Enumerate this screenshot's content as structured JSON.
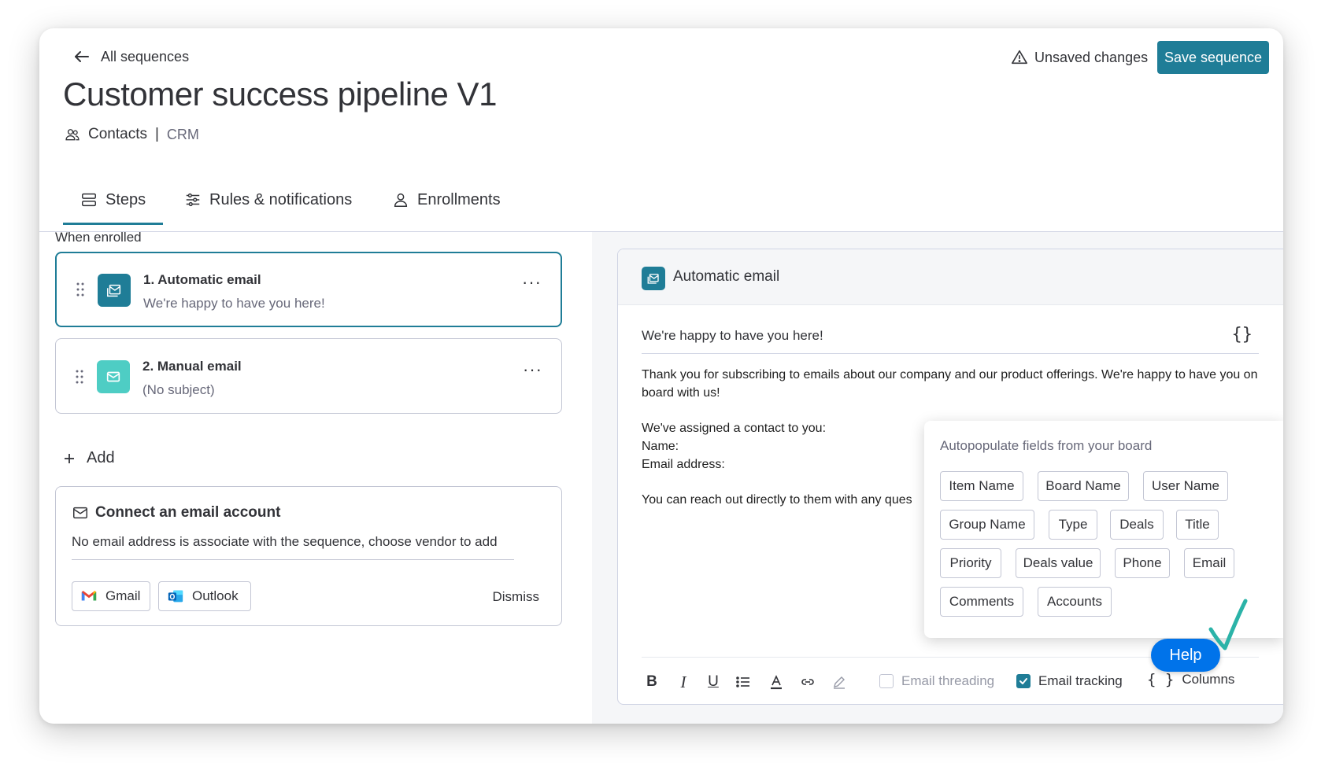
{
  "header": {
    "back_label": "All sequences",
    "title": "Customer success pipeline V1",
    "board": "Contacts",
    "separator": "|",
    "workspace": "CRM",
    "unsaved_label": "Unsaved changes",
    "save_label": "Save sequence"
  },
  "tabs": [
    {
      "label": "Steps",
      "icon": "steps-icon",
      "active": true
    },
    {
      "label": "Rules & notifications",
      "icon": "sliders-icon",
      "active": false
    },
    {
      "label": "Enrollments",
      "icon": "person-icon",
      "active": false
    }
  ],
  "steps_panel": {
    "when_label": "When enrolled",
    "steps": [
      {
        "title": "1.  Automatic email",
        "subtitle": "We're happy to have you here!",
        "icon": "automatic-email-icon",
        "color": "#1f7d97",
        "selected": true
      },
      {
        "title": "2.  Manual email",
        "subtitle": "(No subject)",
        "icon": "envelope-icon",
        "color": "#4ecdc4",
        "selected": false
      }
    ],
    "more_label": "···",
    "add_label": "Add",
    "connect": {
      "title": "Connect an email account",
      "description": "No email address is associate with the sequence, choose vendor to add",
      "gmail_label": "Gmail",
      "outlook_label": "Outlook",
      "dismiss_label": "Dismiss"
    }
  },
  "editor": {
    "header_label": "Automatic email",
    "subject": "We're happy to have you here!",
    "variables_label": "{}",
    "body": {
      "line1": "Thank you for subscribing to emails about our company and our product offerings. We're happy to have you on board with us!",
      "line2": "We've assigned a contact to you:",
      "line3": "Name:",
      "line4": "Email address:",
      "line5": "You can reach out directly to them with any ques"
    },
    "toolbar": {
      "bold": "B",
      "italic": "I",
      "underline": "U",
      "email_threading_label": "Email threading",
      "email_threading_checked": false,
      "email_tracking_label": "Email tracking",
      "email_tracking_checked": true,
      "columns_braces": "{ }",
      "columns_label": "Columns"
    }
  },
  "autopopulate": {
    "title": "Autopopulate fields from your board",
    "fields": [
      "Item Name",
      "Board Name",
      "User Name",
      "Group Name",
      "Type",
      "Deals",
      "Title",
      "Priority",
      "Deals value",
      "Phone",
      "Email",
      "Comments",
      "Accounts"
    ]
  },
  "help_label": "Help",
  "colors": {
    "accent": "#1f7d97",
    "help": "#0073ea",
    "manual_email": "#4ecdc4",
    "annotation": "#2bb3a8"
  }
}
